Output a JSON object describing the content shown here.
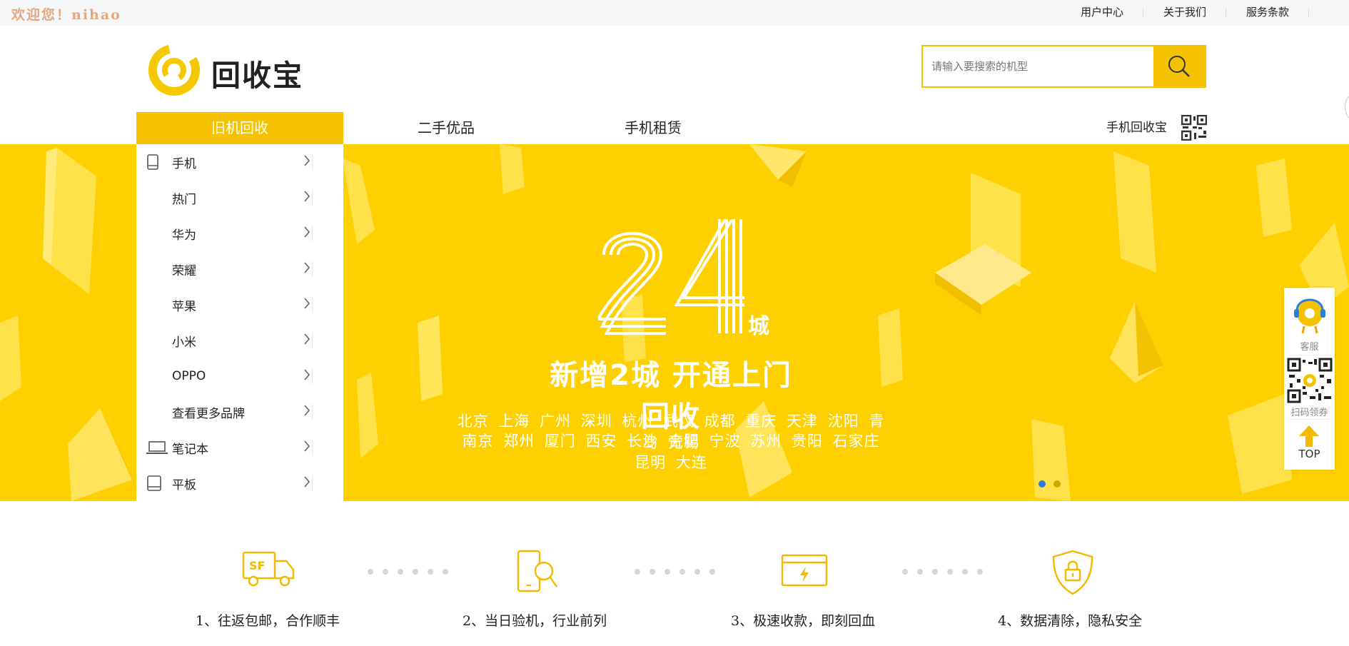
{
  "topbar": {
    "welcome": "欢迎您！nihao",
    "links": [
      "用户中心",
      "关于我们",
      "服务条款"
    ]
  },
  "header": {
    "logo_text": "回收宝",
    "search_placeholder": "请输入要搜索的机型",
    "icon": "search-icon"
  },
  "nav": {
    "items": [
      "旧机回收",
      "二手优品",
      "手机租赁"
    ],
    "qr_label": "手机回收宝",
    "qr_icon": "qr-code-icon"
  },
  "categories": [
    {
      "label": "手机",
      "icon": "phone-icon"
    },
    {
      "label": "热门"
    },
    {
      "label": "华为"
    },
    {
      "label": "荣耀"
    },
    {
      "label": "苹果"
    },
    {
      "label": "小米"
    },
    {
      "label": "OPPO"
    },
    {
      "label": "查看更多品牌"
    },
    {
      "label": "笔记本",
      "icon": "laptop-icon"
    },
    {
      "label": "平板",
      "icon": "tablet-icon"
    }
  ],
  "banner": {
    "number": "24",
    "unit": "城",
    "title": "新增2城 开通上门回收",
    "cities_line1": "北京 上海 广州 深圳 杭州 武汉 成都 重庆 天津 沈阳 青岛 无锡",
    "cities_line2": "南京 郑州 厦门 西安 长沙 合肥 宁波 苏州 贵阳 石家庄 昆明 大连",
    "slides": 2,
    "active_slide": 1,
    "bg_color": "#ffd000"
  },
  "side": {
    "service_label": "客服",
    "qr_label": "扫码领券",
    "top_label": "TOP"
  },
  "features": [
    {
      "text": "1、往返包邮，合作顺丰",
      "icon": "sf-truck-icon"
    },
    {
      "text": "2、当日验机，行业前列",
      "icon": "phone-inspect-icon"
    },
    {
      "text": "3、极速收款，即刻回血",
      "icon": "card-payment-icon"
    },
    {
      "text": "4、数据清除，隐私安全",
      "icon": "shield-lock-icon"
    }
  ],
  "colors": {
    "accent": "#f5c200",
    "welcome": "#e5a77f",
    "dot_active": "#2a7fd4"
  }
}
